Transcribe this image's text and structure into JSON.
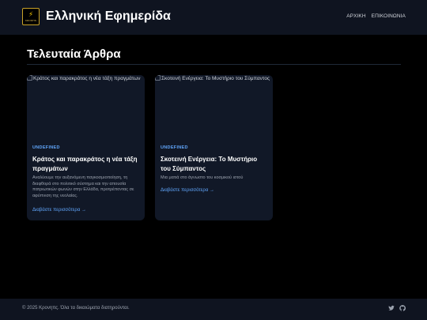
{
  "header": {
    "logo_text": "KRONTIS",
    "site_title": "Ελληνική Εφημερίδα",
    "nav": [
      "ΑΡΧΙΚΗ",
      "ΕΠΙΚΟΙΝΩΝΙΑ"
    ]
  },
  "main": {
    "section_title": "Τελευταία Άρθρα",
    "articles": [
      {
        "image_alt": "Κράτος και παρακράτος η νέα τάξη πραγμάτων",
        "category": "UNDEFINED",
        "title": "Κράτος και παρακράτος η νέα τάξη πραγμάτων",
        "description": "Αναλύουμε την αυξανόμενη παγκοσμιοποίηση, τη διαφθορά στο πολιτικό σύστημα και την απουσία πατριωτικών φωνών στην Ελλάδα, προτρέποντας σε αφύπνιση της νεολαίας.",
        "read_more": "Διαβάστε περισσότερα →"
      },
      {
        "image_alt": "Σκοτεινή Ενέργεια: Το Μυστήριο του Σύμπαντος",
        "category": "UNDEFINED",
        "title": "Σκοτεινή Ενέργεια: Το Μυστήριο του Σύμπαντος",
        "description": "Μια ματιά στο άγνωστο του κοσμικού ιστού",
        "read_more": "Διαβάστε περισσότερα →"
      }
    ]
  },
  "footer": {
    "copyright": "© 2025 Κρονηπς. Όλα τα δικαιώματα διατηρούνται.",
    "social_icons": [
      "twitter-icon",
      "github-icon"
    ]
  },
  "colors": {
    "background": "#000000",
    "header_bg": "#0f1420",
    "card_bg": "#111827",
    "accent": "#60a5fa",
    "logo_bolt": "#f5c400"
  }
}
